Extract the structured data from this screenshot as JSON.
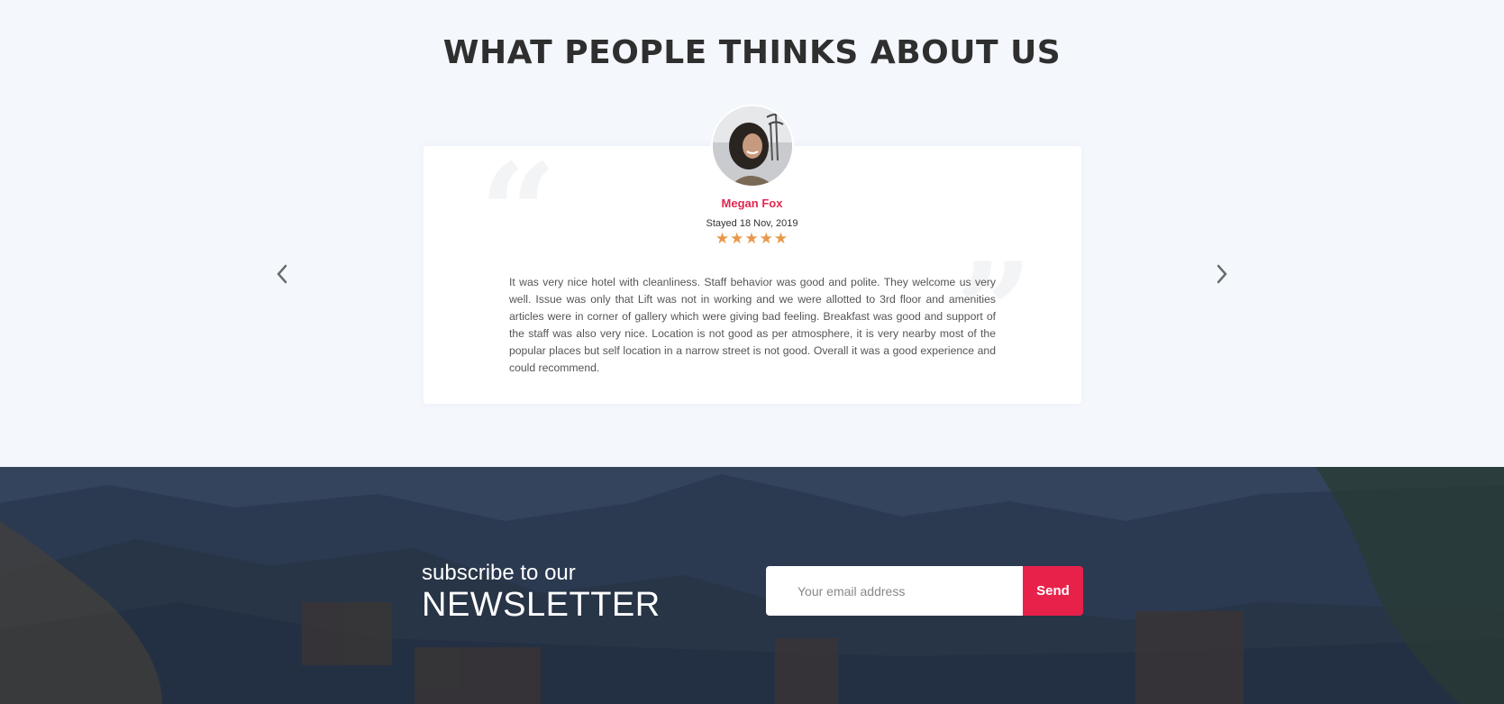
{
  "testimonials": {
    "title": "WHAT PEOPLE THINKS ABOUT US",
    "review": {
      "name": "Megan Fox",
      "stayed": "Stayed 18 Nov, 2019",
      "rating": 5,
      "stars": "★★★★★",
      "text": "It was very nice hotel with cleanliness. Staff behavior was good and polite. They welcome us very well. Issue was only that Lift was not in working and we were allotted to 3rd floor and amenities articles were in corner of gallery which were giving bad feeling. Breakfast was good and support of the staff was also very nice. Location is not good as per atmosphere, it is very nearby most of the popular places but self location in a narrow street is not good. Overall it was a good experience and could recommend."
    },
    "prev_icon": "chevron-left-icon",
    "next_icon": "chevron-right-icon"
  },
  "newsletter": {
    "subtitle": "subscribe to our",
    "title": "NEWSLETTER",
    "email_placeholder": "Your email address",
    "send_label": "Send"
  },
  "colors": {
    "accent": "#e8214b",
    "name": "#e0284f",
    "stars": "#e9974a",
    "newsletter_overlay": "#2e3b52"
  }
}
